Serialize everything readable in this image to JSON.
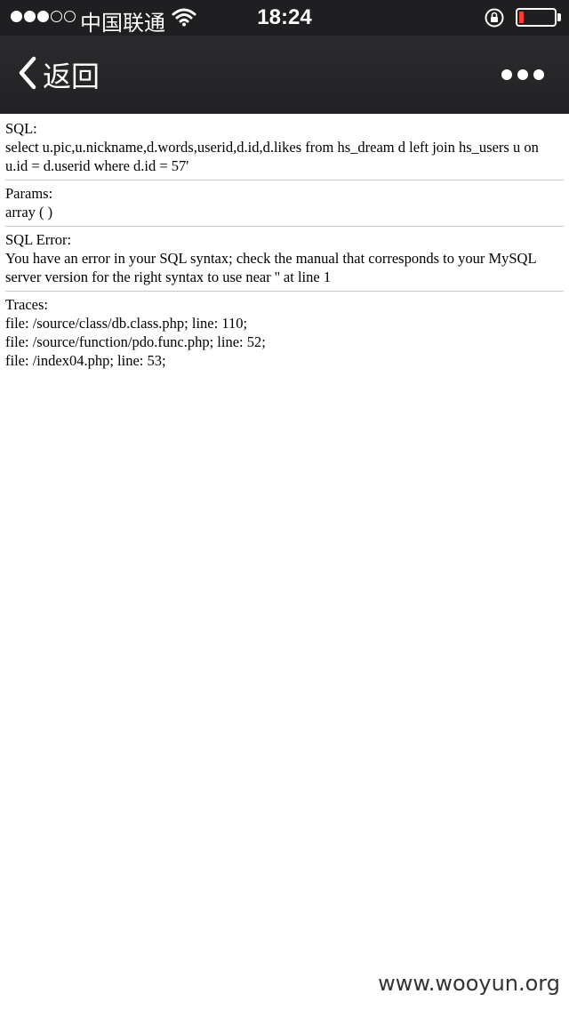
{
  "status_bar": {
    "carrier": "中国联通",
    "time": "18:24",
    "signal_strength": 3,
    "signal_max": 5,
    "battery_level": 0.12,
    "battery_color": "#ff3b30"
  },
  "nav": {
    "back_label": "返回",
    "back_icon": "chevron-left-icon",
    "more_icon": "more-dots-icon"
  },
  "sections": {
    "sql": {
      "label": "SQL:",
      "value": "select u.pic,u.nickname,d.words,userid,d.id,d.likes from hs_dream d left join hs_users u on u.id = d.userid where d.id = 57'"
    },
    "params": {
      "label": "Params:",
      "value": "array ( )"
    },
    "error": {
      "label": "SQL Error:",
      "value": "You have an error in your SQL syntax; check the manual that corresponds to your MySQL server version for the right syntax to use near '' at line 1"
    },
    "traces": {
      "label": "Traces:",
      "items": [
        "file: /source/class/db.class.php; line: 110;",
        "file: /source/function/pdo.func.php; line: 52;",
        "file: /index04.php; line: 53;"
      ]
    }
  },
  "watermark": "www.wooyun.org"
}
